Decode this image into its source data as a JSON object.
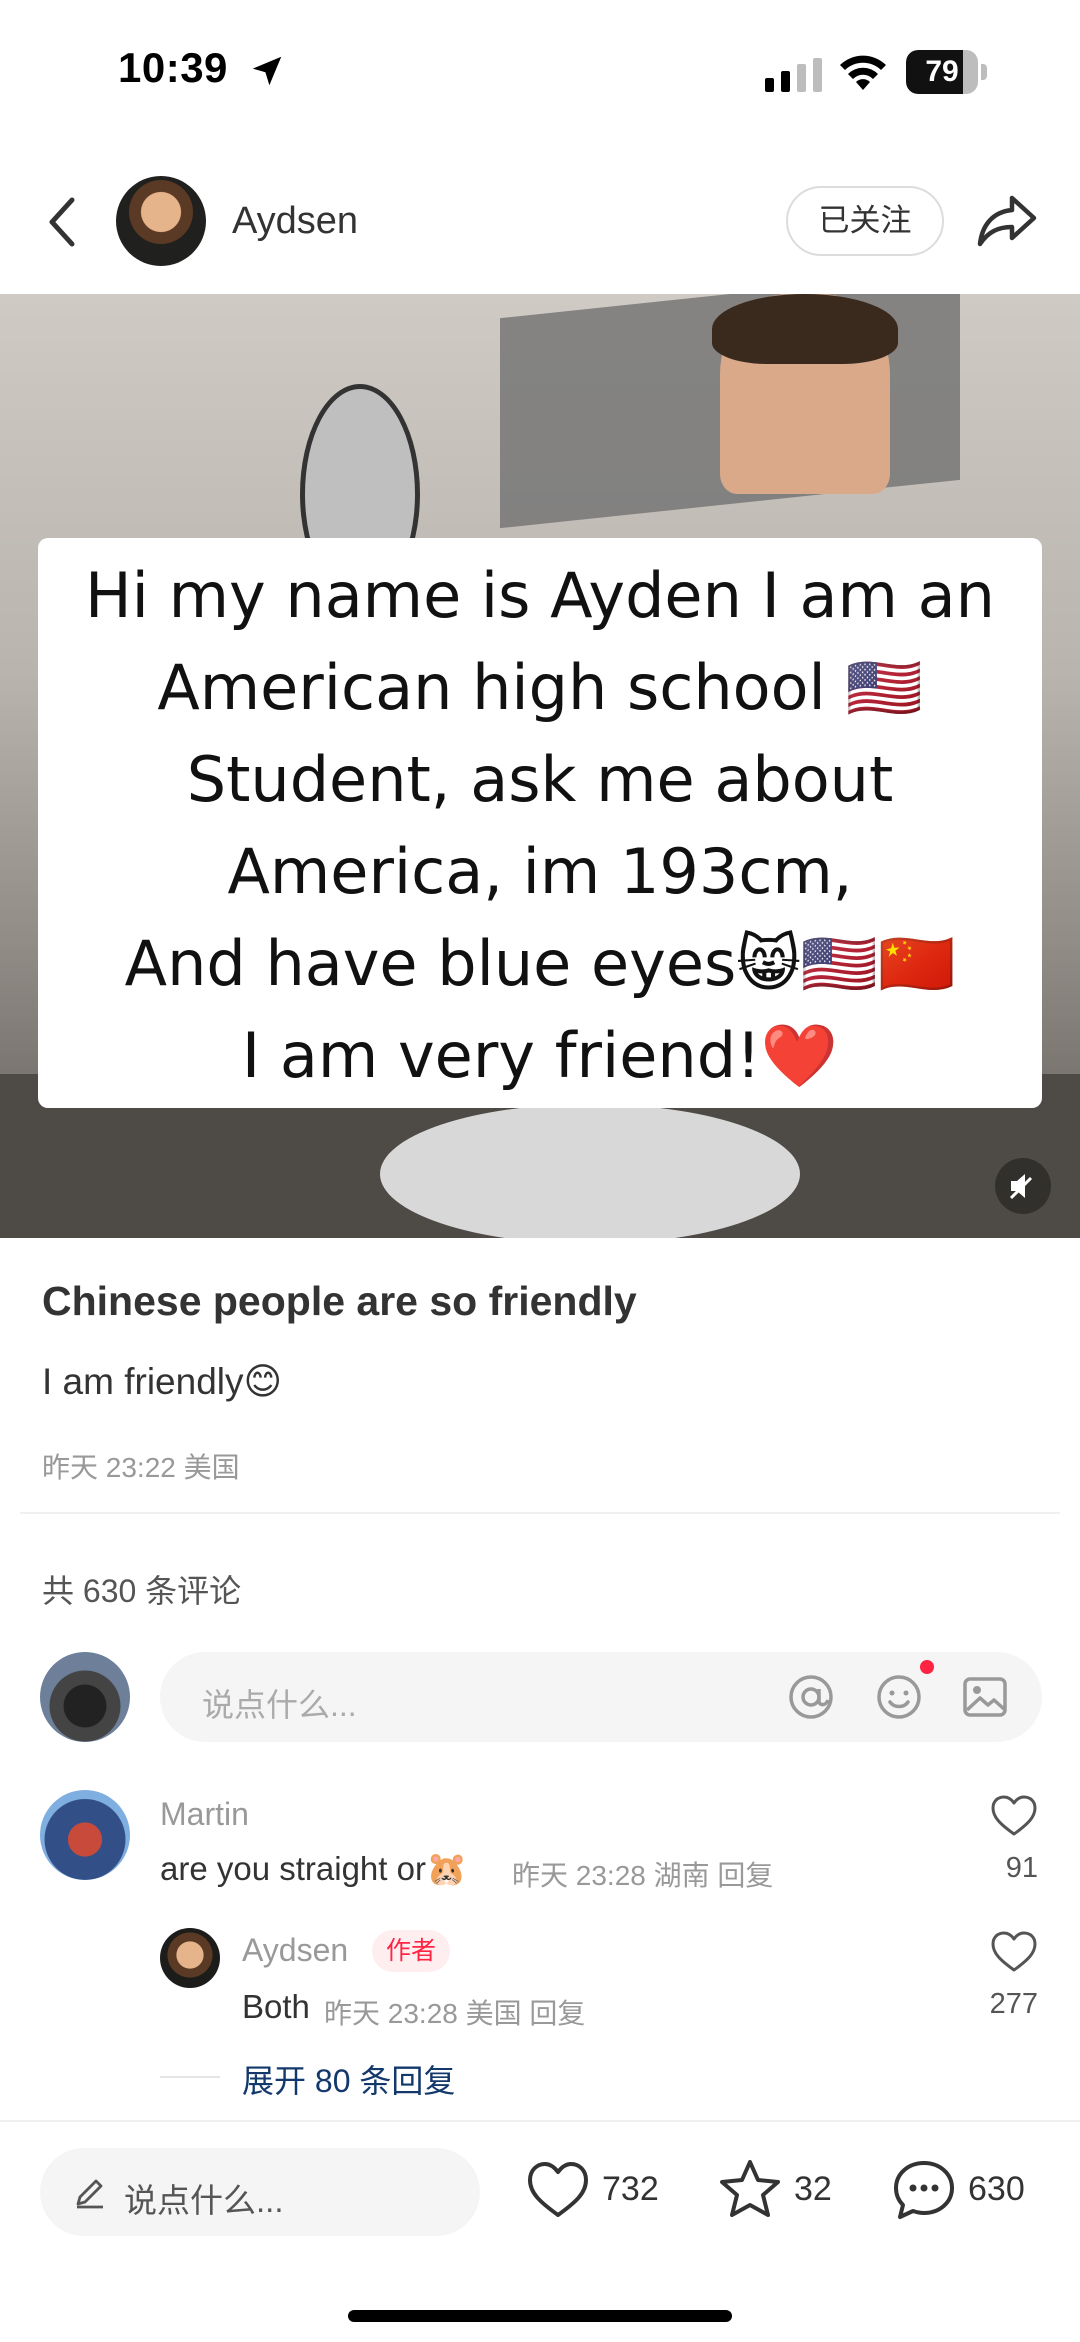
{
  "status_bar": {
    "time": "10:39",
    "battery": "79",
    "battery_level": 0.79
  },
  "header": {
    "author": "Aydsen",
    "follow_label": "已关注"
  },
  "media": {
    "overlay_text": "Hi my name is Ayden I am an\nAmerican high school 🇺🇸\nStudent, ask me about\nAmerica, im 193cm,\nAnd have blue eyes😸🇺🇸🇨🇳\nI am very friend!❤️"
  },
  "post": {
    "title": "Chinese people are so friendly",
    "body": "I am friendly😊",
    "meta": "昨天 23:22 美国"
  },
  "comments": {
    "count_label": "共 630 条评论",
    "input_placeholder": "说点什么...",
    "items": [
      {
        "name": "Martin",
        "text": "are you straight or🐹",
        "meta": "昨天 23:28 湖南 回复",
        "likes": "91"
      },
      {
        "name": "Aydsen",
        "badge": "作者",
        "text": "Both",
        "meta": "昨天 23:28 美国 回复",
        "likes": "277"
      }
    ],
    "expand_label": "展开 80 条回复"
  },
  "bottom_bar": {
    "placeholder": "说点什么...",
    "likes": "732",
    "favorites": "32",
    "comments": "630"
  },
  "icons": [
    "location-arrow-icon",
    "signal-icon",
    "wifi-icon",
    "battery-icon",
    "back-icon",
    "share-icon",
    "mute-icon",
    "at-icon",
    "emoji-icon",
    "image-icon",
    "heart-icon",
    "star-icon",
    "comment-icon",
    "pencil-icon"
  ],
  "colors": {
    "accent": "#ff2442",
    "link": "#13386c"
  }
}
